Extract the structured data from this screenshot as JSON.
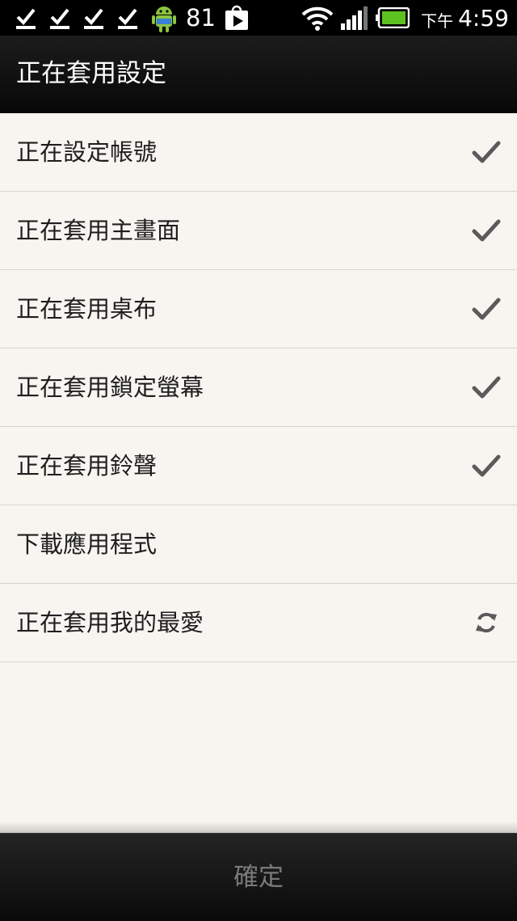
{
  "status_bar": {
    "notification_count": "81",
    "clock_ampm": "下午",
    "clock_time": "4:59",
    "icons": {
      "left": [
        "checkbox-notification-icon",
        "checkbox-notification-icon",
        "checkbox-notification-icon",
        "checkbox-notification-icon",
        "android-robot-icon",
        "play-store-icon"
      ],
      "right": [
        "wifi-icon",
        "signal-icon",
        "battery-icon"
      ]
    },
    "colors": {
      "battery_fill": "#5cc21f"
    }
  },
  "header": {
    "title": "正在套用設定"
  },
  "items": [
    {
      "label": "正在設定帳號",
      "status": "done"
    },
    {
      "label": "正在套用主畫面",
      "status": "done"
    },
    {
      "label": "正在套用桌布",
      "status": "done"
    },
    {
      "label": "正在套用鎖定螢幕",
      "status": "done"
    },
    {
      "label": "正在套用鈴聲",
      "status": "done"
    },
    {
      "label": "下載應用程式",
      "status": "pending"
    },
    {
      "label": "正在套用我的最愛",
      "status": "in-progress"
    }
  ],
  "footer": {
    "confirm_label": "確定"
  }
}
